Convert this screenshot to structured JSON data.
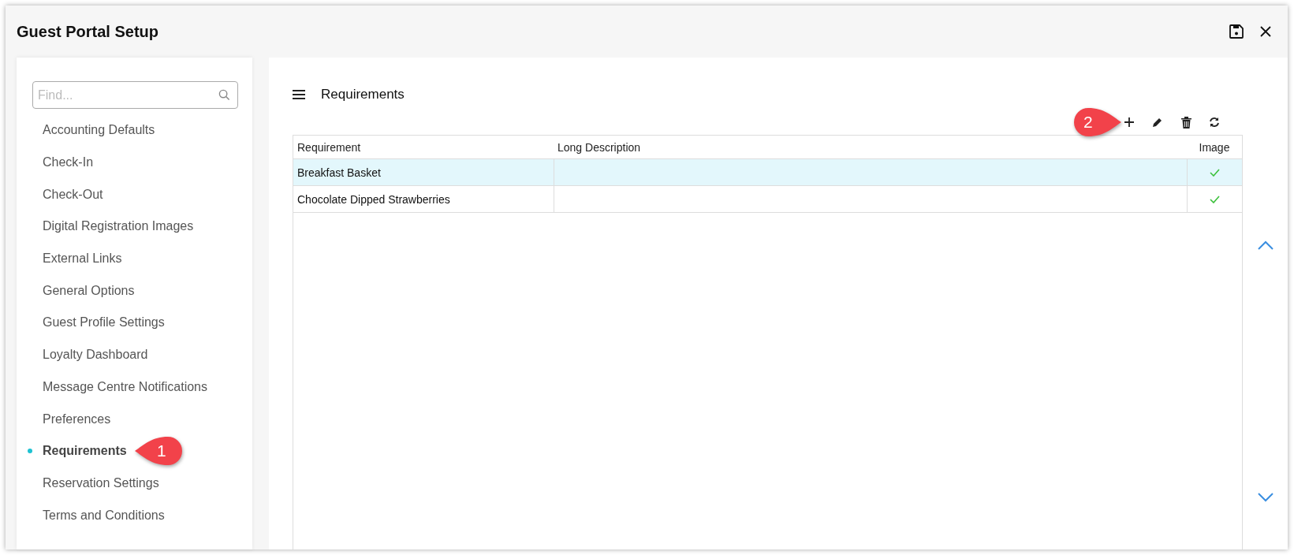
{
  "window": {
    "title": "Guest Portal Setup"
  },
  "sidebar": {
    "search": {
      "placeholder": "Find..."
    },
    "items": [
      {
        "label": "Accounting Defaults",
        "selected": false
      },
      {
        "label": "Check-In",
        "selected": false
      },
      {
        "label": "Check-Out",
        "selected": false
      },
      {
        "label": "Digital Registration Images",
        "selected": false
      },
      {
        "label": "External Links",
        "selected": false
      },
      {
        "label": "General Options",
        "selected": false
      },
      {
        "label": "Guest Profile Settings",
        "selected": false
      },
      {
        "label": "Loyalty Dashboard",
        "selected": false
      },
      {
        "label": "Message Centre Notifications",
        "selected": false
      },
      {
        "label": "Preferences",
        "selected": false
      },
      {
        "label": "Requirements",
        "selected": true,
        "callout": "1"
      },
      {
        "label": "Reservation Settings",
        "selected": false
      },
      {
        "label": "Terms and Conditions",
        "selected": false
      }
    ]
  },
  "content": {
    "title": "Requirements",
    "toolbar": [
      {
        "kind": "add",
        "callout": "2"
      },
      {
        "kind": "edit"
      },
      {
        "kind": "delete"
      },
      {
        "kind": "refresh"
      }
    ],
    "table": {
      "columns": [
        "Requirement",
        "Long Description",
        "Image"
      ],
      "rows": [
        {
          "requirement": "Breakfast Basket",
          "image": true,
          "selected": true
        },
        {
          "requirement": "Chocolate Dipped Strawberries",
          "image": true,
          "selected": false
        }
      ]
    }
  }
}
